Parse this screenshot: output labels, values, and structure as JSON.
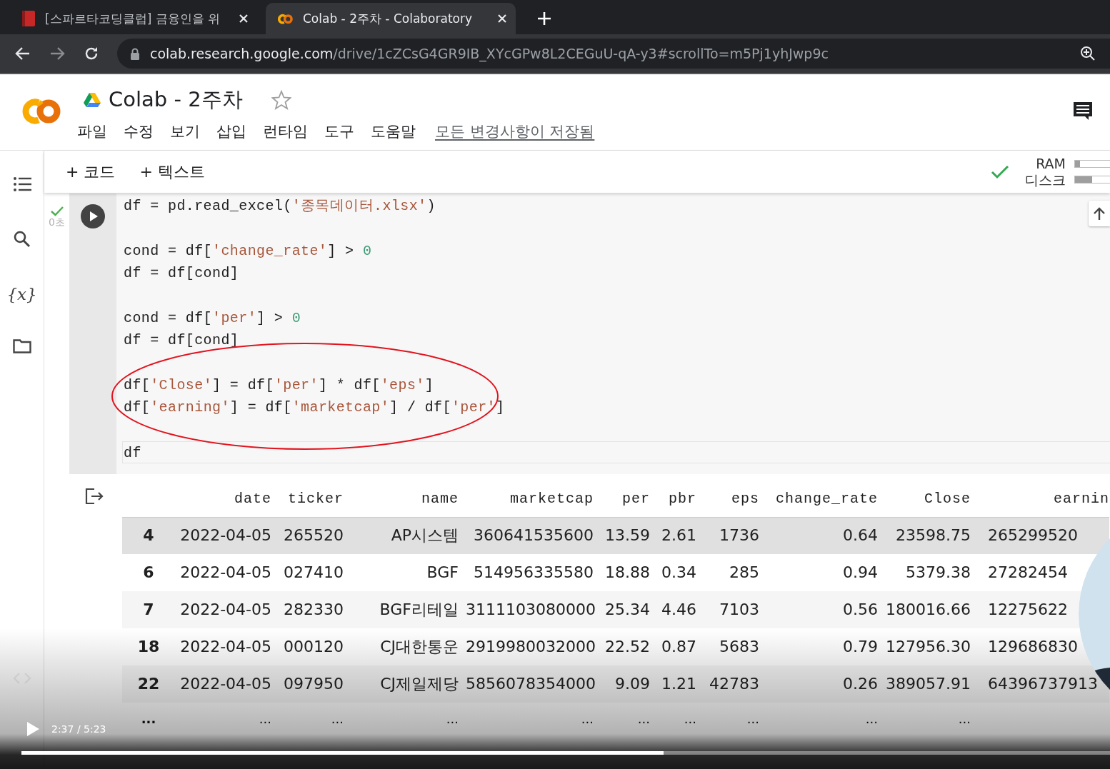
{
  "browser": {
    "tabs": [
      {
        "title": "[스파르타코딩클럽] 금융인을 위",
        "selected": false
      },
      {
        "title": "Colab - 2주차 - Colaboratory",
        "selected": true
      }
    ],
    "url_host": "colab.research.google.com",
    "url_path": "/drive/1cZCsG4GR9IB_XYcGPw8L2CEGuU-qA-y3#scrollTo=m5Pj1yhJwp9c"
  },
  "notebook": {
    "title": "Colab - 2주차",
    "starred": false,
    "menu": [
      "파일",
      "수정",
      "보기",
      "삽입",
      "런타임",
      "도구",
      "도움말"
    ],
    "save_status": "모든 변경사항이 저장됨"
  },
  "sidebar": [
    {
      "kind": "toc"
    },
    {
      "kind": "search"
    },
    {
      "kind": "variables",
      "glyph": "{x}"
    },
    {
      "kind": "files"
    },
    {
      "kind": "code"
    }
  ],
  "toolbar": {
    "buttons": [
      "+ 코드",
      "+ 텍스트"
    ],
    "connected": true,
    "resources": [
      {
        "label": "RAM",
        "level": 0.1
      },
      {
        "label": "디스크",
        "level": 0.35
      }
    ]
  },
  "cell": {
    "done": true,
    "exec_time": "0초",
    "annotated": true,
    "blocks": [
      [
        {
          "current": false,
          "tokens": [
            {
              "kind": "plain",
              "text": "df = pd.read_excel("
            },
            {
              "kind": "string",
              "text": "'종목데이터.xlsx'"
            },
            {
              "kind": "plain",
              "text": ")"
            }
          ]
        }
      ],
      [
        {
          "current": false,
          "tokens": [
            {
              "kind": "plain",
              "text": "cond = df["
            },
            {
              "kind": "string",
              "text": "'change_rate'"
            },
            {
              "kind": "plain",
              "text": "] > "
            },
            {
              "kind": "number",
              "text": "0"
            }
          ]
        },
        {
          "current": false,
          "tokens": [
            {
              "kind": "plain",
              "text": "df = df[cond]"
            }
          ]
        }
      ],
      [
        {
          "current": false,
          "tokens": [
            {
              "kind": "plain",
              "text": "cond = df["
            },
            {
              "kind": "string",
              "text": "'per'"
            },
            {
              "kind": "plain",
              "text": "] > "
            },
            {
              "kind": "number",
              "text": "0"
            }
          ]
        },
        {
          "current": false,
          "tokens": [
            {
              "kind": "plain",
              "text": "df = df[cond]"
            }
          ]
        }
      ],
      [
        {
          "current": false,
          "tokens": [
            {
              "kind": "plain",
              "text": "df["
            },
            {
              "kind": "string",
              "text": "'Close'"
            },
            {
              "kind": "plain",
              "text": "] = df["
            },
            {
              "kind": "string",
              "text": "'per'"
            },
            {
              "kind": "plain",
              "text": "] * df["
            },
            {
              "kind": "string",
              "text": "'eps'"
            },
            {
              "kind": "plain",
              "text": "]"
            }
          ]
        },
        {
          "current": false,
          "tokens": [
            {
              "kind": "plain",
              "text": "df["
            },
            {
              "kind": "string",
              "text": "'earning'"
            },
            {
              "kind": "plain",
              "text": "] = df["
            },
            {
              "kind": "string",
              "text": "'marketcap'"
            },
            {
              "kind": "plain",
              "text": "] / df["
            },
            {
              "kind": "string",
              "text": "'per'"
            },
            {
              "kind": "plain",
              "text": "]"
            }
          ]
        }
      ],
      [
        {
          "current": true,
          "tokens": [
            {
              "kind": "plain",
              "text": "df"
            }
          ]
        }
      ]
    ]
  },
  "output": {
    "columns": [
      "date",
      "ticker",
      "name",
      "marketcap",
      "per",
      "pbr",
      "eps",
      "change_rate",
      "Close",
      "earnin"
    ],
    "rows": [
      {
        "index": "4",
        "highlighted": true,
        "cells": [
          "2022-04-05",
          "265520",
          "AP시스템",
          "360641535600",
          "13.59",
          "2.61",
          "1736",
          "0.64",
          "23598.75",
          "265299520"
        ]
      },
      {
        "index": "6",
        "highlighted": false,
        "cells": [
          "2022-04-05",
          "027410",
          "BGF",
          "514956335580",
          "18.88",
          "0.34",
          "285",
          "0.94",
          "5379.38",
          "27282454"
        ]
      },
      {
        "index": "7",
        "highlighted": false,
        "cells": [
          "2022-04-05",
          "282330",
          "BGF리테일",
          "3111103080000",
          "25.34",
          "4.46",
          "7103",
          "0.56",
          "180016.66",
          "12275622"
        ]
      },
      {
        "index": "18",
        "highlighted": false,
        "cells": [
          "2022-04-05",
          "000120",
          "CJ대한통운",
          "2919980032000",
          "22.52",
          "0.87",
          "5683",
          "0.79",
          "127956.30",
          "129686830"
        ]
      },
      {
        "index": "22",
        "highlighted": false,
        "cells": [
          "2022-04-05",
          "097950",
          "CJ제일제당",
          "5856078354000",
          "9.09",
          "1.21",
          "42783",
          "0.26",
          "389057.91",
          "64396737913"
        ]
      },
      {
        "index": "...",
        "highlighted": false,
        "cells": [
          "...",
          "...",
          "...",
          "...",
          "...",
          "...",
          "...",
          "...",
          "..."
        ]
      }
    ]
  },
  "player": {
    "playing": false,
    "time": "2:37 / 5:23",
    "progress": {
      "level": 0.59
    }
  }
}
